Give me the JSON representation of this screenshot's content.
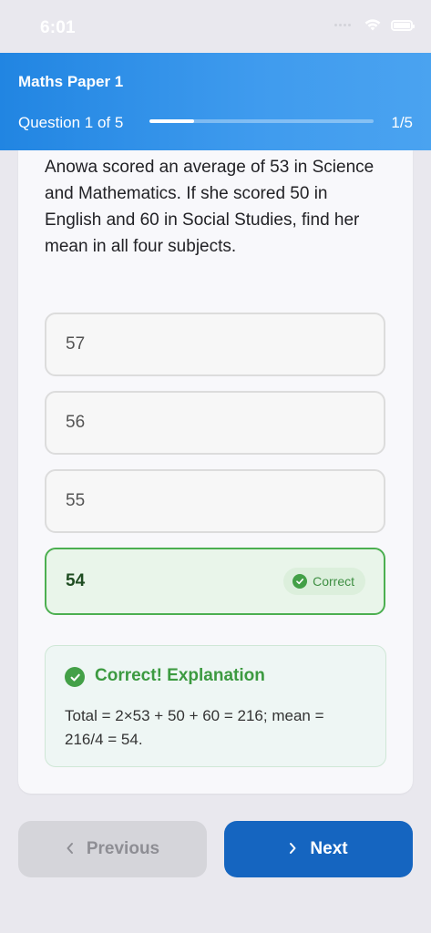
{
  "status_bar": {
    "time": "6:01"
  },
  "header": {
    "title": "Maths Paper 1",
    "question_label": "Question 1 of 5",
    "count": "1/5",
    "progress": 0.2
  },
  "question": {
    "text": "Anowa scored an average of 53 in Science and Mathematics. If she scored 50 in English and 60 in Social Studies, find her mean in all four subjects."
  },
  "options": [
    {
      "label": "57"
    },
    {
      "label": "56"
    },
    {
      "label": "55"
    },
    {
      "label": "54",
      "badge": "Correct"
    }
  ],
  "explanation": {
    "title": "Correct! Explanation",
    "body": "Total = 2×53 + 50 + 60 = 216; mean = 216/4 = 54."
  },
  "navigation": {
    "previous_label": "Previous",
    "next_label": "Next"
  },
  "colors": {
    "accent": "#1565c0",
    "correct": "#43a047"
  }
}
